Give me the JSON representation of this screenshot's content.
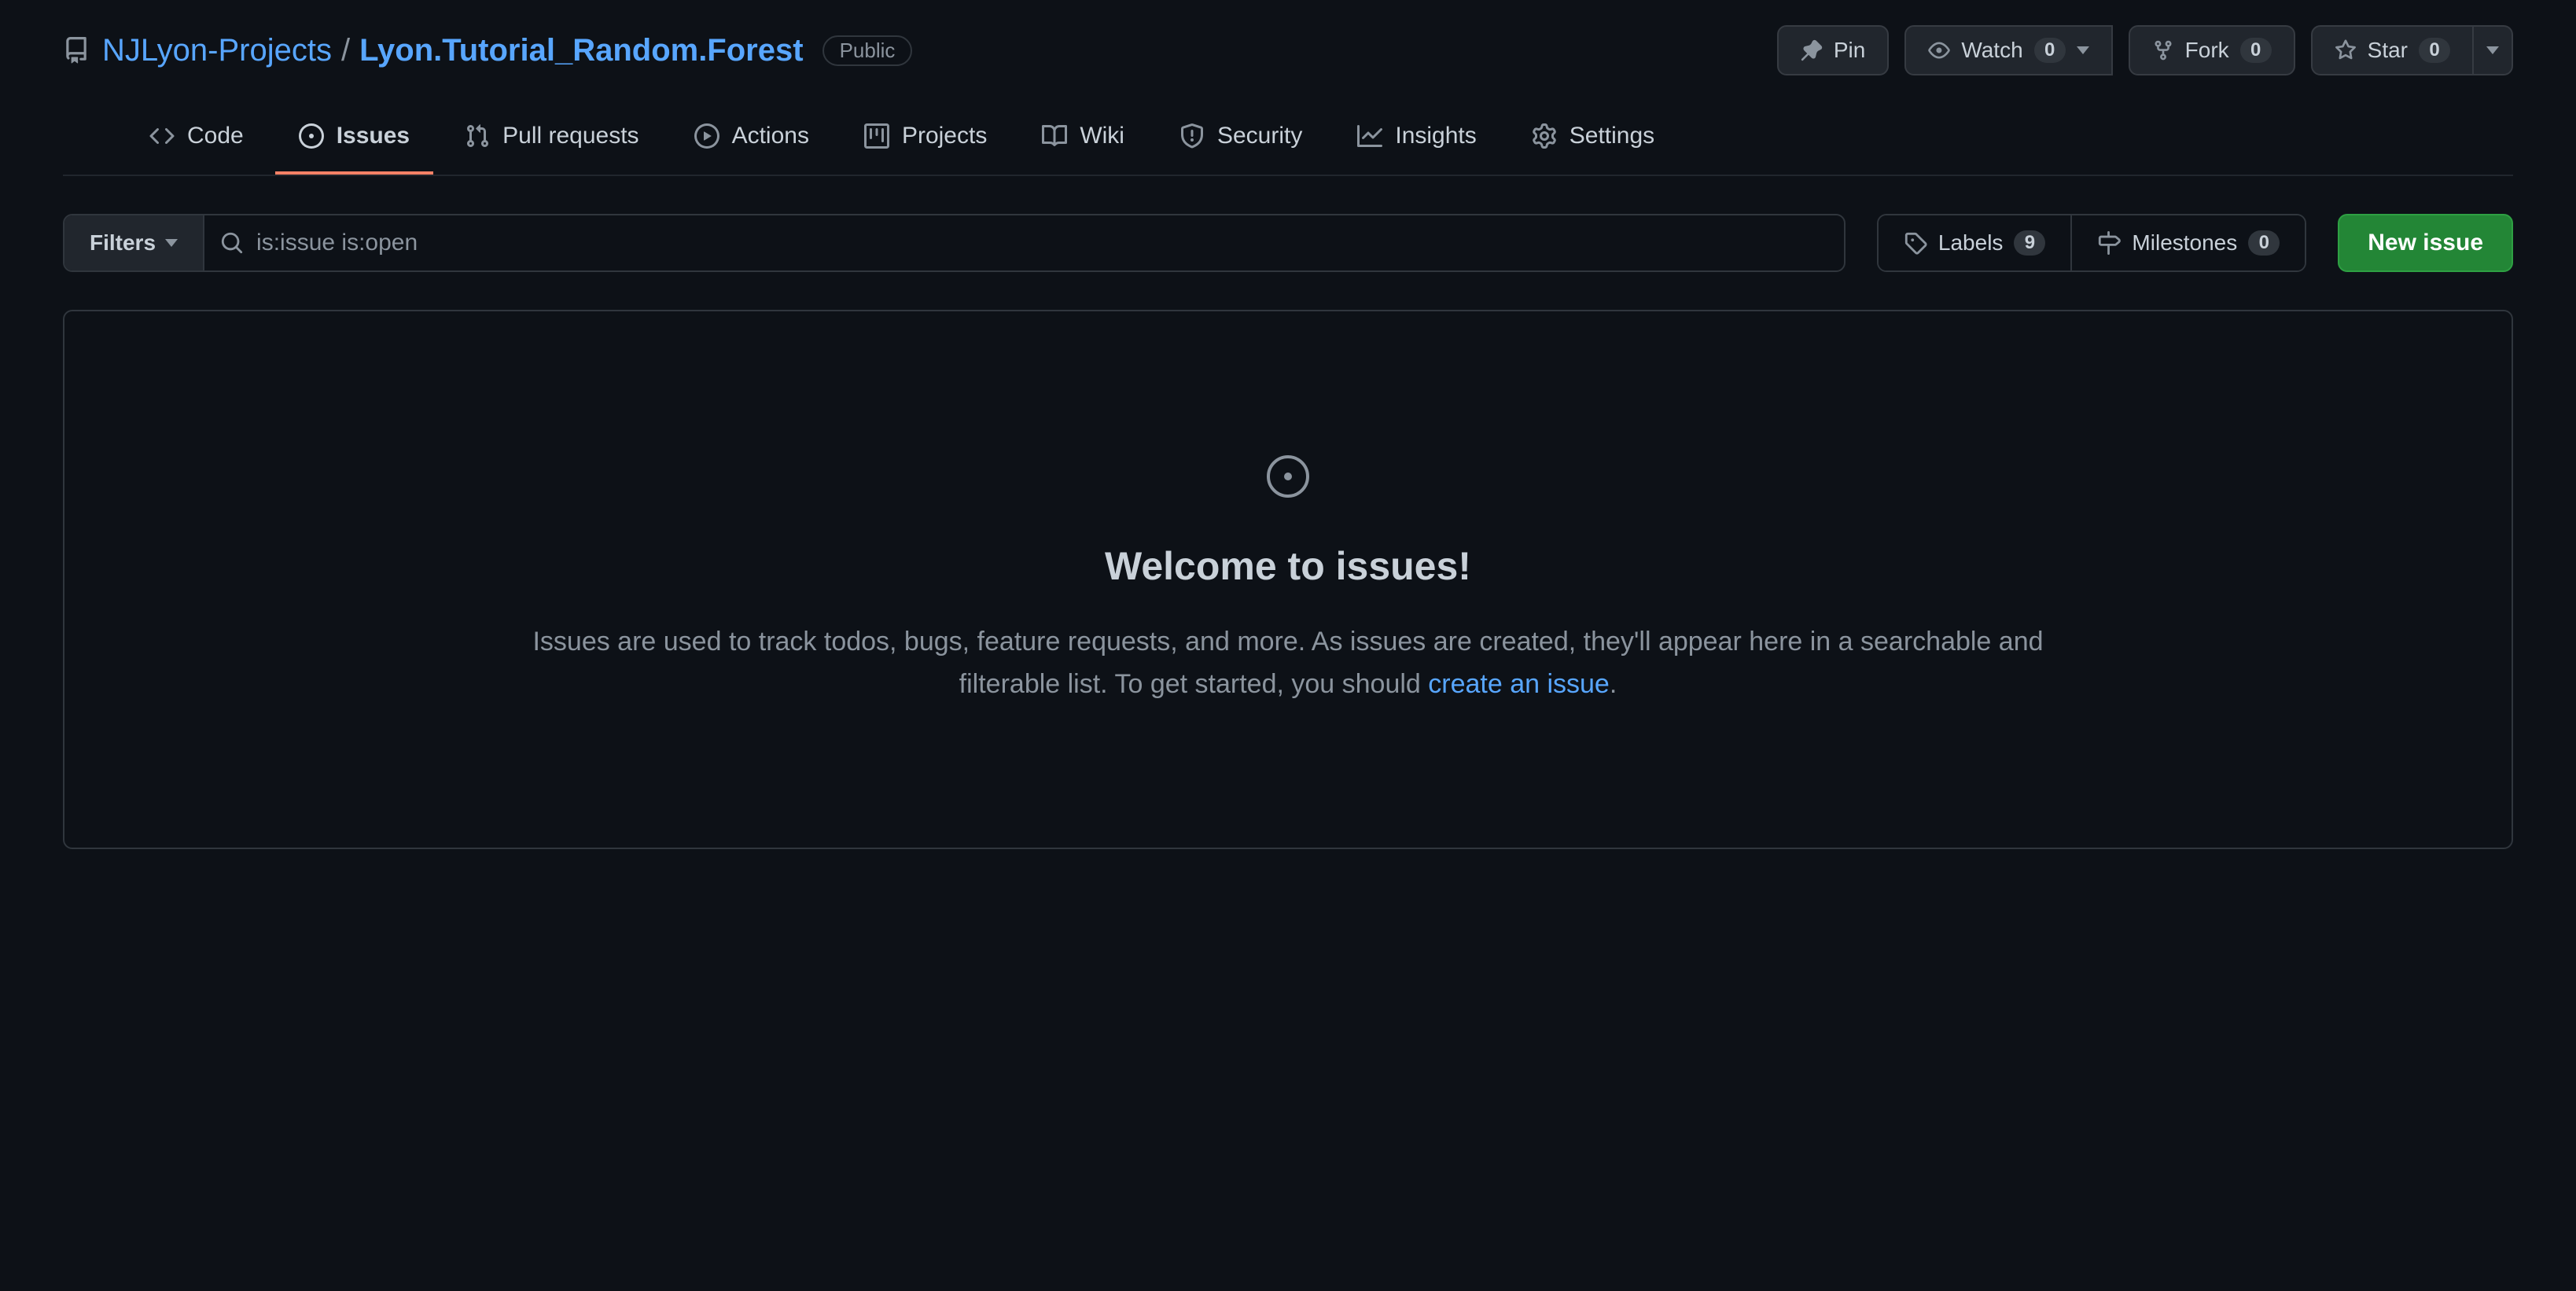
{
  "repo": {
    "owner": "NJLyon-Projects",
    "separator": "/",
    "name": "Lyon.Tutorial_Random.Forest",
    "visibility": "Public"
  },
  "actions": {
    "pin": "Pin",
    "watch": {
      "label": "Watch",
      "count": "0"
    },
    "fork": {
      "label": "Fork",
      "count": "0"
    },
    "star": {
      "label": "Star",
      "count": "0"
    }
  },
  "nav": {
    "code": "Code",
    "issues": "Issues",
    "pulls": "Pull requests",
    "actions": "Actions",
    "projects": "Projects",
    "wiki": "Wiki",
    "security": "Security",
    "insights": "Insights",
    "settings": "Settings"
  },
  "toolbar": {
    "filters_label": "Filters",
    "search_value": "is:issue is:open",
    "labels": {
      "label": "Labels",
      "count": "9"
    },
    "milestones": {
      "label": "Milestones",
      "count": "0"
    },
    "new_issue": "New issue"
  },
  "empty": {
    "heading": "Welcome to issues!",
    "body_prefix": "Issues are used to track todos, bugs, feature requests, and more. As issues are created, they'll appear here in a searchable and filterable list. To get started, you should ",
    "link_text": "create an issue",
    "body_suffix": "."
  }
}
